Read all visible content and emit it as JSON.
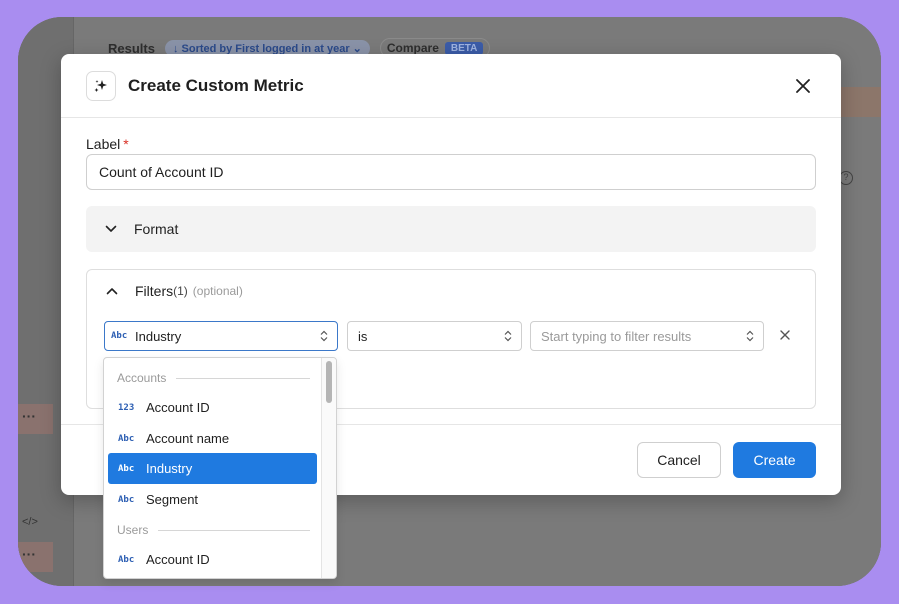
{
  "background": {
    "results_label": "Results",
    "sorted_pill": "↓ Sorted by First logged in at year ⌄",
    "compare_label": "Compare",
    "beta_badge": "BETA",
    "dots": "···",
    "code_icon": "</>"
  },
  "modal": {
    "icon": "sparkles-icon",
    "title": "Create Custom Metric",
    "label_field": {
      "label": "Label",
      "required_mark": "*",
      "value": "Count of Account ID"
    },
    "format_section": {
      "title": "Format",
      "expanded": false
    },
    "filters_section": {
      "title": "Filters",
      "count": "(1)",
      "optional": "(optional)",
      "expanded": true,
      "field_select": {
        "type_icon": "Abc",
        "value": "Industry"
      },
      "operator_select": {
        "value": "is"
      },
      "value_select": {
        "placeholder": "Start typing to filter results"
      }
    },
    "buttons": {
      "cancel": "Cancel",
      "create": "Create"
    }
  },
  "dropdown": {
    "groups": [
      {
        "label": "Accounts",
        "items": [
          {
            "icon": "123",
            "label": "Account ID"
          },
          {
            "icon": "Abc",
            "label": "Account name"
          },
          {
            "icon": "Abc",
            "label": "Industry",
            "selected": true
          },
          {
            "icon": "Abc",
            "label": "Segment"
          }
        ]
      },
      {
        "label": "Users",
        "items": [
          {
            "icon": "Abc",
            "label": "Account ID"
          }
        ]
      }
    ]
  },
  "colors": {
    "accent": "#1f7ae0",
    "backdrop": "#a98df0",
    "required": "#d93025"
  }
}
